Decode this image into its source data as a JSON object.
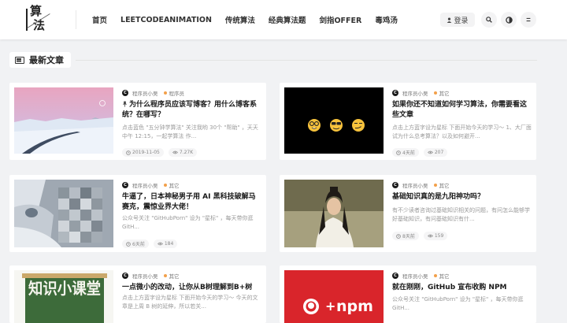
{
  "header": {
    "logo_line1": "算",
    "logo_line2": "法",
    "nav": [
      "首页",
      "LEETCODEANIMATION",
      "传统算法",
      "经典算法题",
      "剑指OFFER",
      "毒鸡汤"
    ],
    "login_label": "登录",
    "icons": [
      "user-icon",
      "search-icon",
      "theme-toggle-icon",
      "menu-icon"
    ]
  },
  "section": {
    "title": "最新文章",
    "icon": "list-icon"
  },
  "articles": [
    {
      "author": "程序员小吴",
      "category": "程序员",
      "title": "为什么程序员应该写博客？用什么博客系统？在哪写？",
      "excerpt": "点击蓝色 \"五分钟学算法\" 关注我哟 30个 \"帮助\" ，天天中午 12:15，一起学算法 作...",
      "date": "2019-11-05",
      "views": "7.27K",
      "pinned": true,
      "thumb": "winter-road"
    },
    {
      "author": "程序员小吴",
      "category": "其它",
      "title": "如果你还不知道如何学习算法，你需要看这些文章",
      "excerpt": "点击上方蓝字设为星标 下面开始今天的学习～ 1、大厂面试为什么总考算法？以及如何避开...",
      "date": "4天前",
      "views": "207",
      "pinned": false,
      "thumb": "emoji-black"
    },
    {
      "author": "程序员小吴",
      "category": "其它",
      "title": "牛逼了，日本神秘男子用 AI 黑科技破解马赛克，震惊业界大佬！",
      "excerpt": "公众号关注 \"GitHubPorn\" 设为 \"星标\" ，每天带你逛 GitH...",
      "date": "6天前",
      "views": "184",
      "pinned": false,
      "thumb": "mosaic"
    },
    {
      "author": "程序员小吴",
      "category": "其它",
      "title": "基础知识真的是九阳神功吗？",
      "excerpt": "有不少读者咨询过基础知识相关的问题，有问怎么能够学好基础知识，有问基础知识有什...",
      "date": "8天前",
      "views": "159",
      "pinned": false,
      "thumb": "film-still"
    },
    {
      "author": "程序员小吴",
      "category": "其它",
      "title": "一点微小的改动，让你从B树理解到B+树",
      "excerpt": "点击上方蓝字设为星标 下面开始今天的学习～ 今天的文章是上周 B 树的延伸，所以若关...",
      "date": "",
      "views": "",
      "pinned": false,
      "thumb": "knowledge"
    },
    {
      "author": "程序员小吴",
      "category": "其它",
      "title": "就在刚刚，GitHub 宣布收购 NPM",
      "excerpt": "公众号关注 \"GitHubPorn\" 设为 \"星标\" ，每天带你逛 GitH...",
      "date": "",
      "views": "",
      "pinned": false,
      "thumb": "github-npm"
    }
  ],
  "thumb_texts": {
    "knowledge": "知识小课堂",
    "npm": "npm"
  },
  "meta_icons": [
    "clock-icon",
    "eye-icon"
  ],
  "colors": {
    "accent": "#f2a04a",
    "npm_red": "#d9252b",
    "knowledge_green": "#3d6b3a"
  }
}
